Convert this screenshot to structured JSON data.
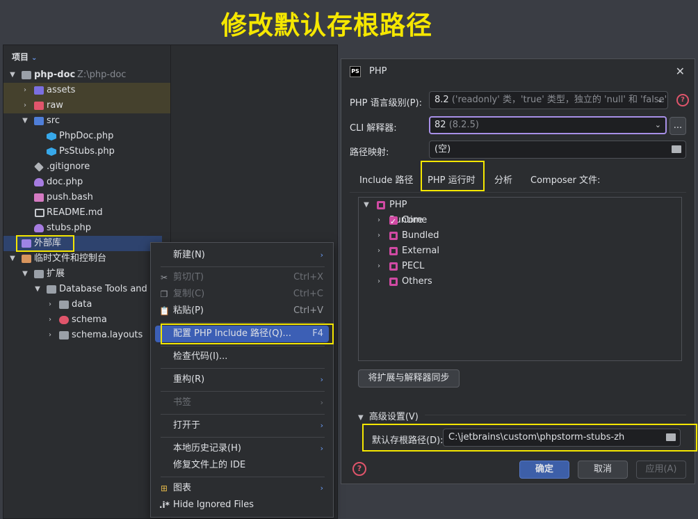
{
  "banner": {
    "title": "修改默认存根路径"
  },
  "project": {
    "header": "项目",
    "tree": [
      {
        "name": "php-doc",
        "path": "Z:\\php-doc"
      },
      {
        "name": "assets"
      },
      {
        "name": "raw"
      },
      {
        "name": "src"
      },
      {
        "name": "PhpDoc.php"
      },
      {
        "name": "PsStubs.php"
      },
      {
        "name": ".gitignore"
      },
      {
        "name": "doc.php"
      },
      {
        "name": "push.bash"
      },
      {
        "name": "README.md"
      },
      {
        "name": "stubs.php"
      },
      {
        "name": "外部库"
      },
      {
        "name": "临时文件和控制台"
      },
      {
        "name": "扩展"
      },
      {
        "name": "Database Tools and SQL"
      },
      {
        "name": "data"
      },
      {
        "name": "schema"
      },
      {
        "name": "schema.layouts"
      }
    ]
  },
  "context_menu": {
    "items": [
      {
        "label": "新建(N)",
        "shortcut": "",
        "submenu": "›"
      },
      {
        "label": "剪切(T)",
        "shortcut": "Ctrl+X"
      },
      {
        "label": "复制(C)",
        "shortcut": "Ctrl+C"
      },
      {
        "label": "粘贴(P)",
        "shortcut": "Ctrl+V"
      },
      {
        "label": "配置 PHP Include 路径(Q)...",
        "shortcut": "F4"
      },
      {
        "label": "检查代码(I)..."
      },
      {
        "label": "重构(R)",
        "submenu": "›"
      },
      {
        "label": "书签",
        "submenu": "›"
      },
      {
        "label": "打开于",
        "submenu": "›"
      },
      {
        "label": "本地历史记录(H)",
        "submenu": "›"
      },
      {
        "label": "修复文件上的 IDE"
      },
      {
        "label": "图表",
        "submenu": "›"
      },
      {
        "label": "Hide Ignored Files"
      }
    ]
  },
  "dialog": {
    "logo": "PS",
    "title": "PHP",
    "close": "✕",
    "language_level_label": "PHP 语言级别(P):",
    "language_level_value": "8.2",
    "language_level_hint": "('readonly' 类，'true' 类型，独立的 'null' 和 'false')",
    "cli_label": "CLI 解释器:",
    "cli_value": "82",
    "cli_hint": "(8.2.5)",
    "cli_more": "...",
    "path_mapping_label": "路径映射:",
    "path_mapping_value": "(空)",
    "tabs": [
      "Include 路径",
      "PHP 运行时",
      "分析",
      "Composer 文件:"
    ],
    "runtime": {
      "root": "PHP Runtime",
      "children": [
        "Core",
        "Bundled",
        "External",
        "PECL",
        "Others"
      ]
    },
    "sync_button": "将扩展与解释器同步",
    "advanced_label": "高级设置(V)",
    "stub_path_label": "默认存根路径(D):",
    "stub_path_value": "C:\\jetbrains\\custom\\phpstorm-stubs-zh",
    "help": "?",
    "ok": "确定",
    "cancel": "取消",
    "apply": "应用(A)"
  }
}
